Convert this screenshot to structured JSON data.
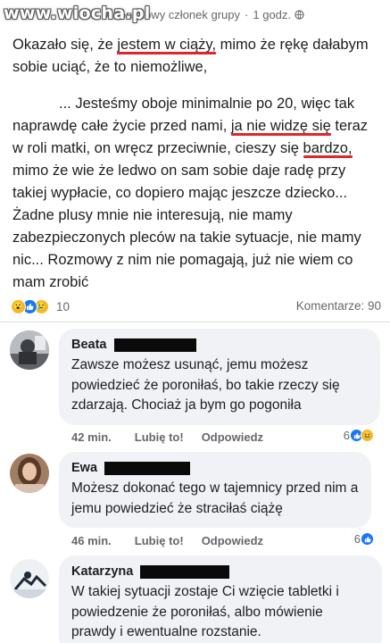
{
  "watermark": "www.wiocha.pl",
  "post": {
    "author": "Anonimowy członek grupy",
    "time": "1 godz.",
    "dot": "·",
    "para1_pre": "Okazało się, że ",
    "para1_u": "jestem w ciąży,",
    "para1_post": " mimo że rękę dałabym sobie uciąć, że to niemożliwe,",
    "para2_pre": "... Jesteśmy oboje minimalnie po 20, więc tak naprawdę całe życie przed nami, ",
    "para2_u1": "ja nie widzę się",
    "para2_u2": "teraz w roli matki, on wręcz przeciwnie, cieszy się",
    "para2_u3": "bardzo,",
    "para2_post": " mimo że wie że ledwo on sam sobie daje radę przy takiej wypłacie, co dopiero mając jeszcze dziecko... Żadne plusy mnie nie interesują, nie mamy zabezpieczonych pleców na takie sytuacje, nie mamy nic... Rozmowy z nim nie pomagają, już nie wiem co mam zrobić"
  },
  "reactions": {
    "count": "10",
    "comments": "Komentarze: 90",
    "icons": [
      "wow-icon",
      "like-icon",
      "sad-icon"
    ]
  },
  "comments": [
    {
      "name": "Beata",
      "text": "Zawsze możesz usunąć, jemu możesz powiedzieć że poroniłaś, bo takie rzeczy się zdarzają. Chociaż ja bym go pogoniła",
      "time": "42 min.",
      "like": "Lubię to!",
      "reply": "Odpowiedz",
      "reactions": "6"
    },
    {
      "name": "Ewa",
      "text": "Możesz dokonać tego w tajemnicy przed nim a jemu powiedzieć że straciłaś ciążę",
      "time": "46 min.",
      "like": "Lubię to!",
      "reply": "Odpowiedz",
      "reactions": "6"
    },
    {
      "name": "Katarzyna",
      "text": "W takiej sytuacji zostaje Ci wzięcie tabletki i powiedzenie że poroniłaś, albo mówienie prawdy i ewentualne rozstanie."
    }
  ],
  "colors": {
    "underline": "#e0262a",
    "bubble": "#f0f2f5",
    "secondary_text": "#65676b",
    "like_blue": "#1877f2"
  }
}
